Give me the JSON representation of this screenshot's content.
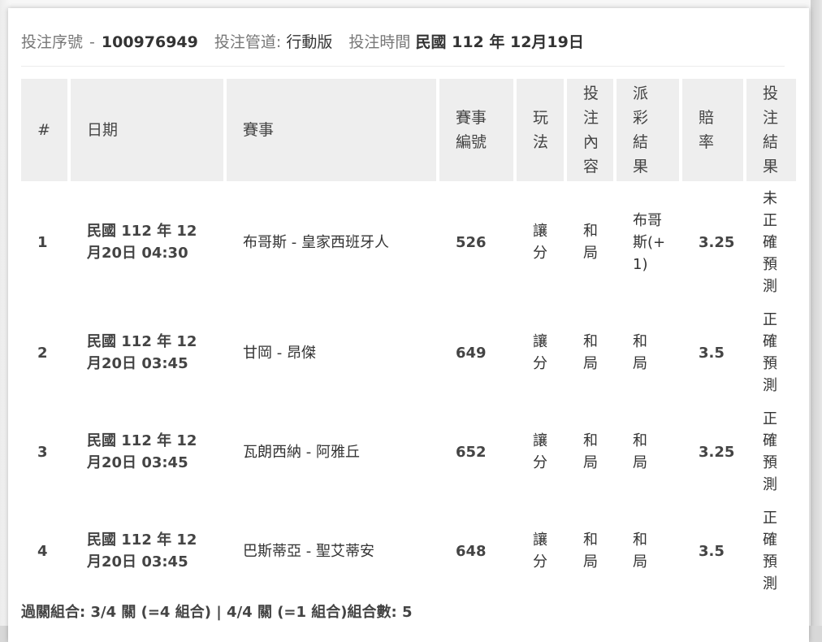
{
  "header": {
    "serial_label": "投注序號",
    "serial_value": "100976949",
    "channel_label": "投注管道:",
    "channel_value": "行動版",
    "time_label": "投注時間",
    "time_value": "民國 112 年 12月19日"
  },
  "table": {
    "columns": [
      "#",
      "日期",
      "賽事",
      "賽事編號",
      "玩法",
      "投注內容",
      "派彩結果",
      "賠率",
      "投注結果"
    ],
    "rows": [
      {
        "no": "1",
        "date": "民國 112 年 12月20日 04:30",
        "match": "布哥斯 - 皇家西班牙人",
        "match_id": "526",
        "play": "讓分",
        "bet": "和局",
        "payout": "布哥斯(+1)",
        "odds": "3.25",
        "result": "未正確預測"
      },
      {
        "no": "2",
        "date": "民國 112 年 12月20日 03:45",
        "match": "甘岡 - 昂傑",
        "match_id": "649",
        "play": "讓分",
        "bet": "和局",
        "payout": "和局",
        "odds": "3.5",
        "result": "正確預測"
      },
      {
        "no": "3",
        "date": "民國 112 年 12月20日 03:45",
        "match": "瓦朗西納 - 阿雅丘",
        "match_id": "652",
        "play": "讓分",
        "bet": "和局",
        "payout": "和局",
        "odds": "3.25",
        "result": "正確預測"
      },
      {
        "no": "4",
        "date": "民國 112 年 12月20日 03:45",
        "match": "巴斯蒂亞 - 聖艾蒂安",
        "match_id": "648",
        "play": "讓分",
        "bet": "和局",
        "payout": "和局",
        "odds": "3.5",
        "result": "正確預測"
      }
    ]
  },
  "footer": {
    "text": "過關組合: 3/4 關 (=4 組合) | 4/4 關 (=1 組合)組合數: 5"
  }
}
